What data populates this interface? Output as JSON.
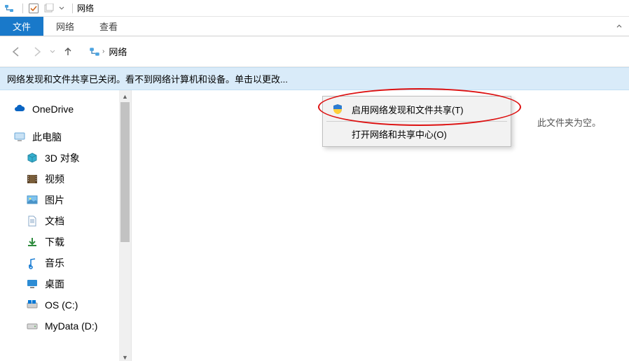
{
  "titlebar": {
    "title": "网络"
  },
  "ribbon": {
    "tabs": [
      {
        "label": "文件",
        "active": true
      },
      {
        "label": "网络",
        "active": false
      },
      {
        "label": "查看",
        "active": false
      }
    ]
  },
  "nav": {
    "breadcrumb_root": "网络"
  },
  "banner": {
    "text": "网络发现和文件共享已关闭。看不到网络计算机和设备。单击以更改..."
  },
  "sidebar": {
    "items": [
      {
        "icon": "cloud",
        "label": "OneDrive",
        "child": false
      },
      {
        "icon": "pc",
        "label": "此电脑",
        "child": false
      },
      {
        "icon": "cube",
        "label": "3D 对象",
        "child": true
      },
      {
        "icon": "film",
        "label": "视频",
        "child": true
      },
      {
        "icon": "image",
        "label": "图片",
        "child": true
      },
      {
        "icon": "doc",
        "label": "文档",
        "child": true
      },
      {
        "icon": "download",
        "label": "下载",
        "child": true
      },
      {
        "icon": "music",
        "label": "音乐",
        "child": true
      },
      {
        "icon": "desktop",
        "label": "桌面",
        "child": true
      },
      {
        "icon": "drive-os",
        "label": "OS (C:)",
        "child": true
      },
      {
        "icon": "drive",
        "label": "MyData (D:)",
        "child": true
      }
    ]
  },
  "main": {
    "empty_text": "此文件夹为空。"
  },
  "context_menu": {
    "items": [
      {
        "icon": "shield",
        "label": "启用网络发现和文件共享(T)"
      },
      {
        "icon": "",
        "label": "打开网络和共享中心(O)"
      }
    ]
  }
}
